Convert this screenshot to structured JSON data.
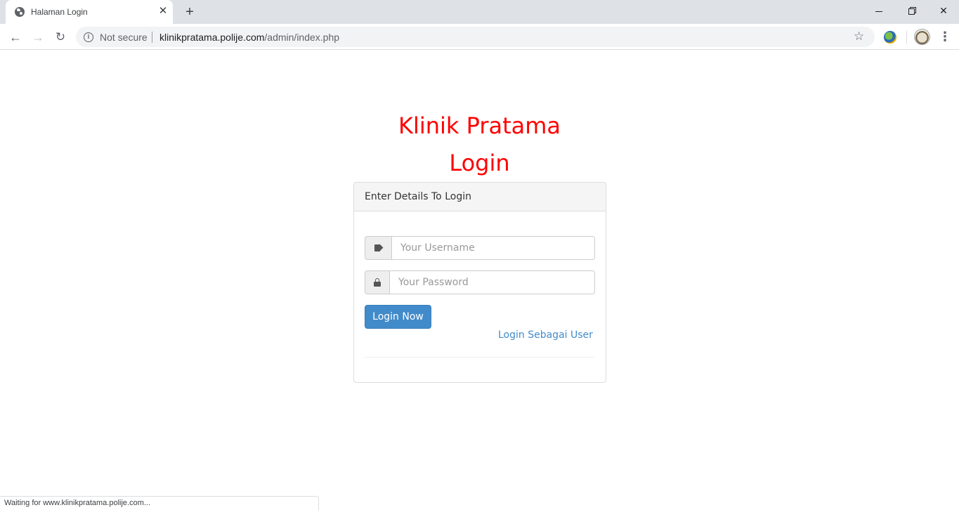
{
  "browser": {
    "tab": {
      "title": "Halaman Login",
      "favicon": "globe-icon",
      "close_label": "✕"
    },
    "new_tab_label": "+",
    "window_controls": {
      "close_label": "✕"
    },
    "nav": {
      "back_label": "←",
      "forward_label": "→",
      "reload_label": "↻"
    },
    "omnibox": {
      "security_label": "Not secure",
      "url_host": "klinikpratama.polije.com",
      "url_path": "/admin/index.php",
      "bookmark_icon": "☆"
    },
    "menu_label": "⋮",
    "status_text": "Waiting for www.klinikpratama.polije.com..."
  },
  "page": {
    "site_title": "Klinik Pratama",
    "subtitle": "Login",
    "title_color": "#ff0000",
    "panel": {
      "heading": "Enter Details To Login",
      "username": {
        "placeholder": "Your Username",
        "value": "",
        "icon": "tag-icon"
      },
      "password": {
        "placeholder": "Your Password",
        "value": "",
        "icon": "lock-icon"
      },
      "submit_label": "Login Now",
      "user_link_label": "Login Sebagai User"
    },
    "accent_color": "#428bca"
  }
}
